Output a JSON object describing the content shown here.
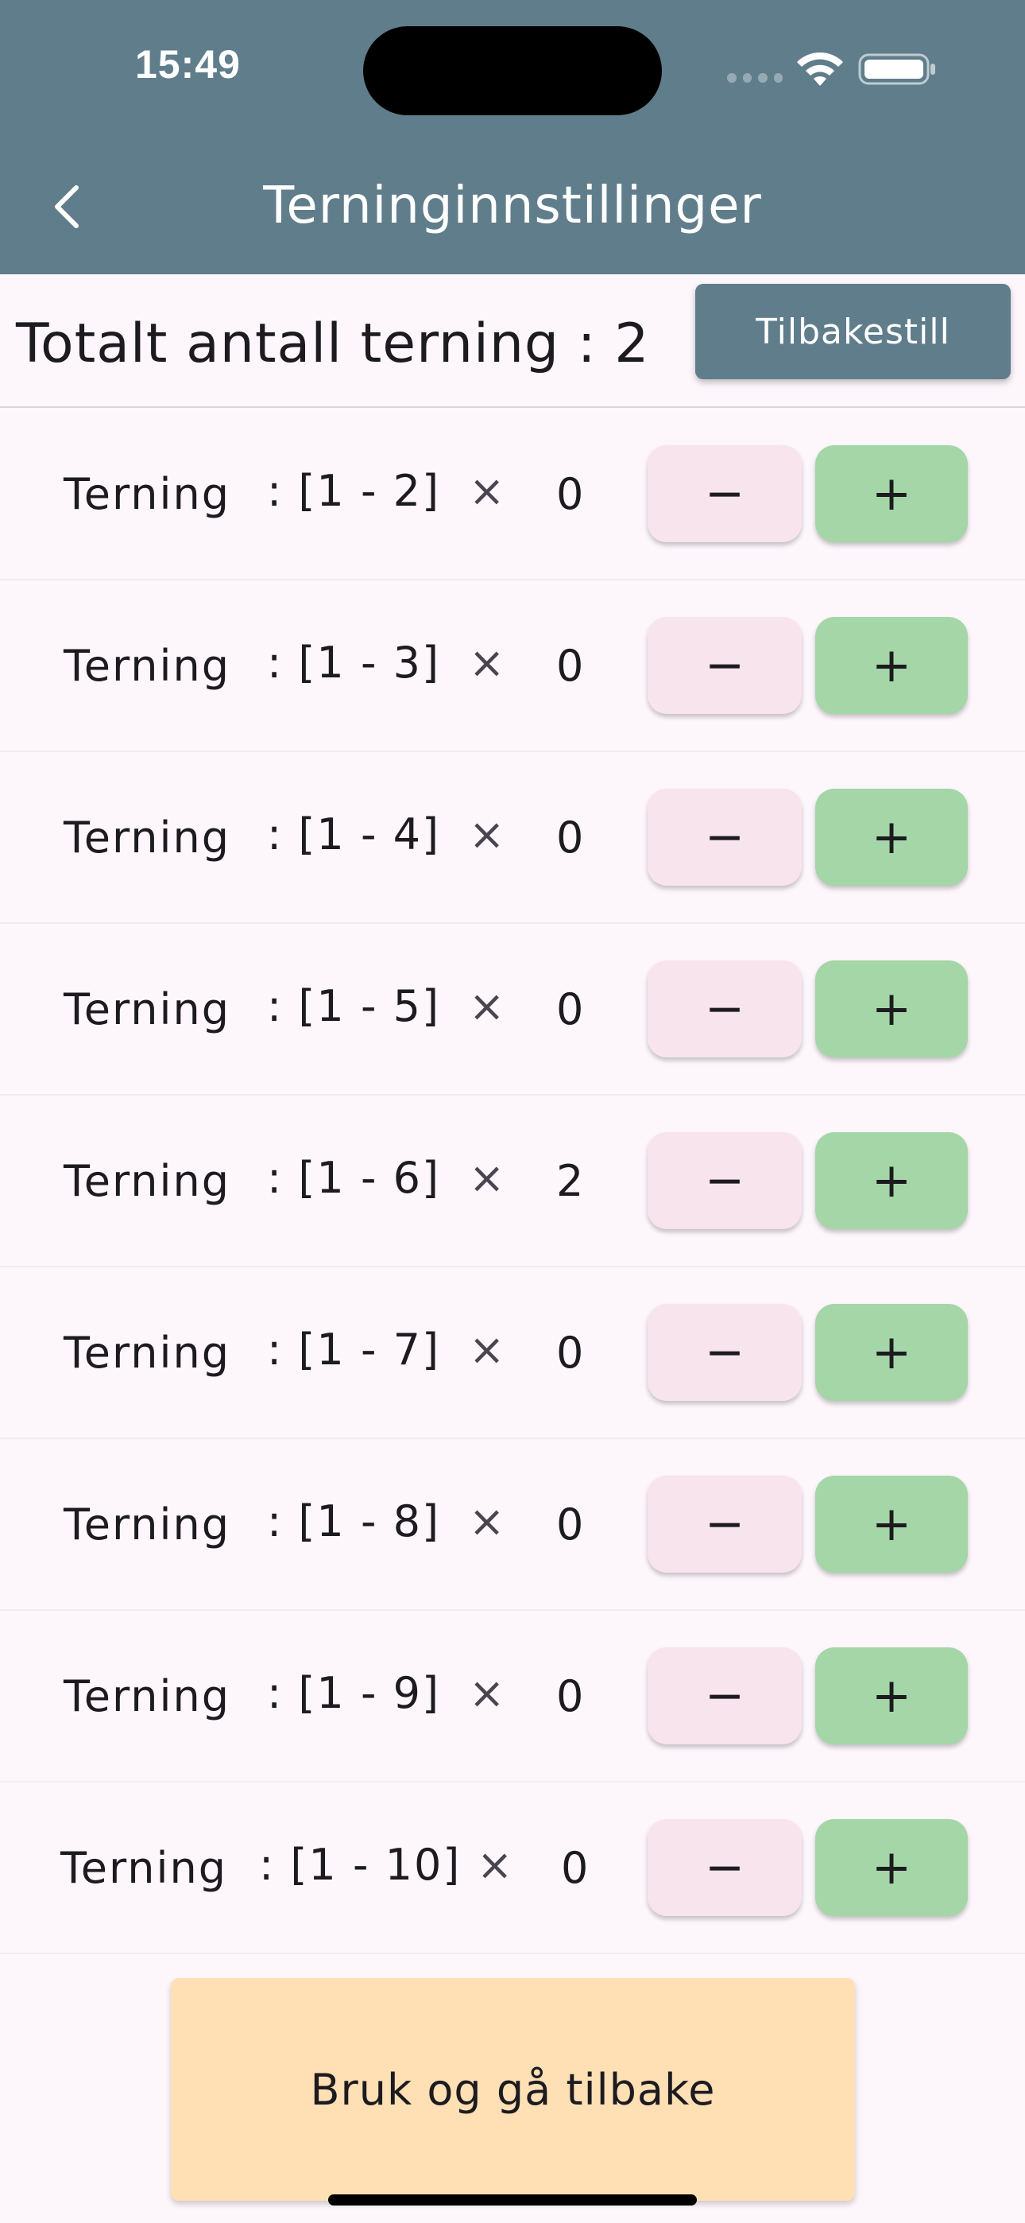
{
  "status_bar": {
    "time": "15:49"
  },
  "app_bar": {
    "title": "Terninginnstillinger",
    "back_icon": "chevron-left-icon"
  },
  "summary": {
    "total_label": "Totalt antall terning  : 2",
    "reset_label": "Tilbakestill"
  },
  "dice": [
    {
      "name": "Terning",
      "range": ": [1 - 2]",
      "times": "×",
      "count": "0",
      "minus": "−",
      "plus": "+"
    },
    {
      "name": "Terning",
      "range": ": [1 - 3]",
      "times": "×",
      "count": "0",
      "minus": "−",
      "plus": "+"
    },
    {
      "name": "Terning",
      "range": ": [1 - 4]",
      "times": "×",
      "count": "0",
      "minus": "−",
      "plus": "+"
    },
    {
      "name": "Terning",
      "range": ": [1 - 5]",
      "times": "×",
      "count": "0",
      "minus": "−",
      "plus": "+"
    },
    {
      "name": "Terning",
      "range": ": [1 - 6]",
      "times": "×",
      "count": "2",
      "minus": "−",
      "plus": "+"
    },
    {
      "name": "Terning",
      "range": ": [1 - 7]",
      "times": "×",
      "count": "0",
      "minus": "−",
      "plus": "+"
    },
    {
      "name": "Terning",
      "range": ": [1 - 8]",
      "times": "×",
      "count": "0",
      "minus": "−",
      "plus": "+"
    },
    {
      "name": "Terning",
      "range": ": [1 - 9]",
      "times": "×",
      "count": "0",
      "minus": "−",
      "plus": "+"
    },
    {
      "name": "Terning",
      "range": ": [1 - 10]",
      "times": "×",
      "count": "0",
      "minus": "−",
      "plus": "+"
    }
  ],
  "footer": {
    "apply_label": "Bruk og gå tilbake"
  },
  "colors": {
    "app_bar": "#607d8b",
    "background": "#fdf7fc",
    "minus_button": "#f8e4ec",
    "plus_button": "#a4d6a7",
    "apply_button": "#fee0b4"
  }
}
